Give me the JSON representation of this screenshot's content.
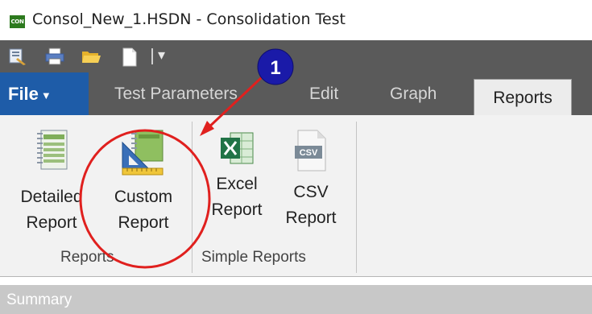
{
  "window": {
    "app_icon_text": "CON",
    "title": "Consol_New_1.HSDN - Consolidation Test"
  },
  "quick_access": {
    "overflow_label": "▾"
  },
  "tabs": {
    "file": "File",
    "items": [
      "Test Parameters",
      "Edit",
      "Graph"
    ],
    "active": "Reports"
  },
  "ribbon": {
    "groups": [
      {
        "label": "Reports",
        "buttons": [
          {
            "line1": "Detailed",
            "line2": "Report",
            "icon": "detailed-report-icon"
          },
          {
            "line1": "Custom",
            "line2": "Report",
            "icon": "custom-report-icon"
          }
        ]
      },
      {
        "label": "Simple Reports",
        "buttons": [
          {
            "line1": "Excel",
            "line2": "Report",
            "icon": "excel-icon"
          },
          {
            "line1": "CSV",
            "line2": "Report",
            "icon": "csv-file-icon",
            "icon_text": "CSV"
          }
        ]
      }
    ]
  },
  "status": {
    "text": "Summary"
  },
  "annotation": {
    "callout_number": "1",
    "callout_color": "#1a1aa8",
    "highlight_color": "#e0201e"
  }
}
